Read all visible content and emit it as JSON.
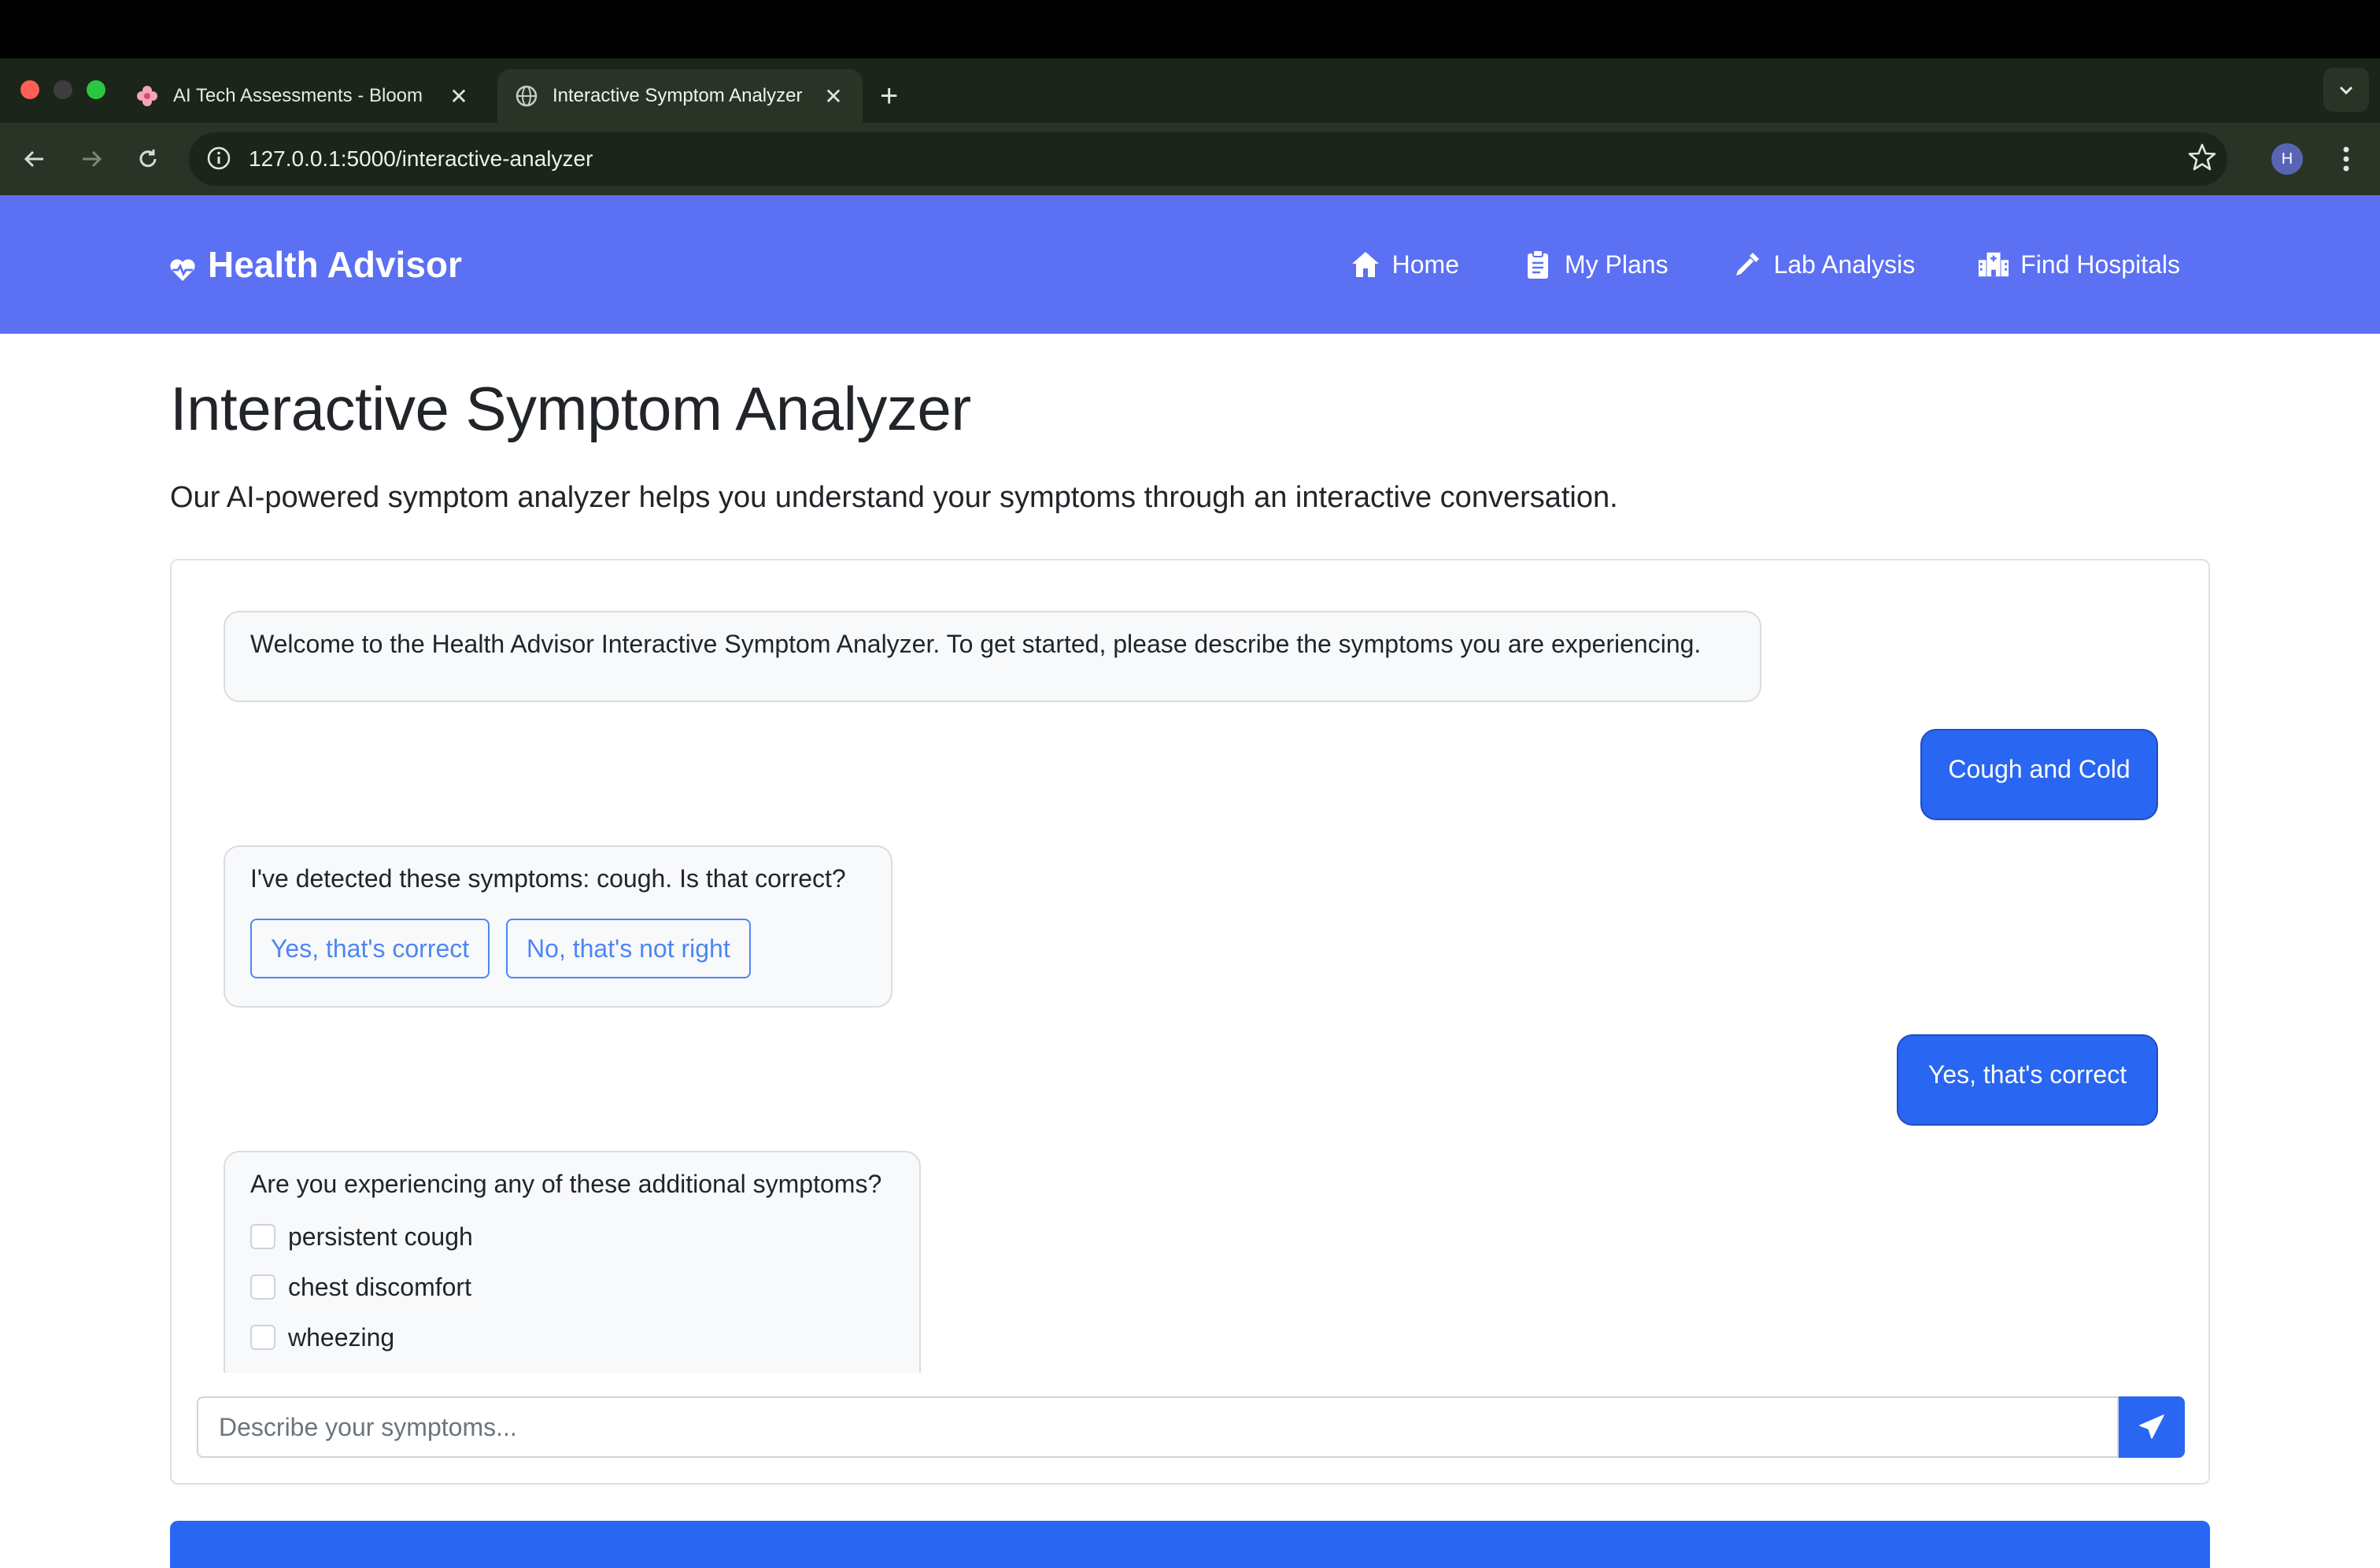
{
  "browser": {
    "tabs": [
      {
        "title": "AI Tech Assessments - Bloom",
        "active": false,
        "favicon": "bloom-flower-icon"
      },
      {
        "title": "Interactive Symptom Analyzer",
        "active": true,
        "favicon": "globe-icon"
      }
    ],
    "url": "127.0.0.1:5000/interactive-analyzer",
    "profile_initial": "H"
  },
  "nav": {
    "brand": "Health Advisor",
    "links": [
      {
        "label": "Home",
        "icon": "home-icon"
      },
      {
        "label": "My Plans",
        "icon": "clipboard-icon"
      },
      {
        "label": "Lab Analysis",
        "icon": "pipette-icon"
      },
      {
        "label": "Find Hospitals",
        "icon": "hospital-icon"
      }
    ]
  },
  "page": {
    "title": "Interactive Symptom Analyzer",
    "lead": "Our AI-powered symptom analyzer helps you understand your symptoms through an interactive conversation."
  },
  "chat": {
    "welcome": "Welcome to the Health Advisor Interactive Symptom Analyzer. To get started, please describe the symptoms you are experiencing.",
    "user_1": "Cough and Cold",
    "detected": "I've detected these symptoms: cough. Is that correct?",
    "confirm_yes": "Yes, that's correct",
    "confirm_no": "No, that's not right",
    "user_2": "Yes, that's correct",
    "additional_question": "Are you experiencing any of these additional symptoms?",
    "additional_options": [
      "persistent cough",
      "chest discomfort",
      "wheezing"
    ],
    "input_placeholder": "Describe your symptoms..."
  },
  "colors": {
    "nav_bg": "#5b70f2",
    "primary": "#2966f1",
    "outline": "#4d86f4"
  }
}
